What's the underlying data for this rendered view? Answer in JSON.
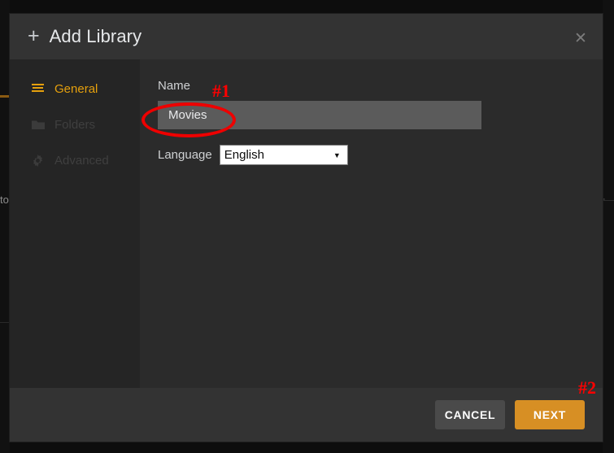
{
  "backdrop": {
    "left_text": "to",
    "right_glyph": "·"
  },
  "modal": {
    "header": {
      "plus_icon": "plus-icon",
      "title": "Add Library",
      "close_icon": "✕"
    },
    "sidebar": {
      "items": [
        {
          "label": "General",
          "icon": "hamburger-icon",
          "state": "active"
        },
        {
          "label": "Folders",
          "icon": "folder-icon",
          "state": "disabled"
        },
        {
          "label": "Advanced",
          "icon": "gear-icon",
          "state": "disabled"
        }
      ]
    },
    "form": {
      "name_label": "Name",
      "name_value": "Movies",
      "name_placeholder": "",
      "language_label": "Language",
      "language_value": "English",
      "language_options": [
        "English"
      ],
      "caret": "▼"
    },
    "footer": {
      "cancel_label": "CANCEL",
      "next_label": "NEXT"
    }
  },
  "annotations": {
    "marker_1": "#1",
    "marker_2": "#2",
    "highlight_color": "#ee0000"
  },
  "colors": {
    "accent": "#e5a00d",
    "primary_button": "#d78f24",
    "annotation_red": "#ff0000",
    "modal_bg": "#2b2b2b",
    "sidebar_bg": "#252525",
    "header_bg": "#333333",
    "input_bg": "#5b5b5b"
  }
}
